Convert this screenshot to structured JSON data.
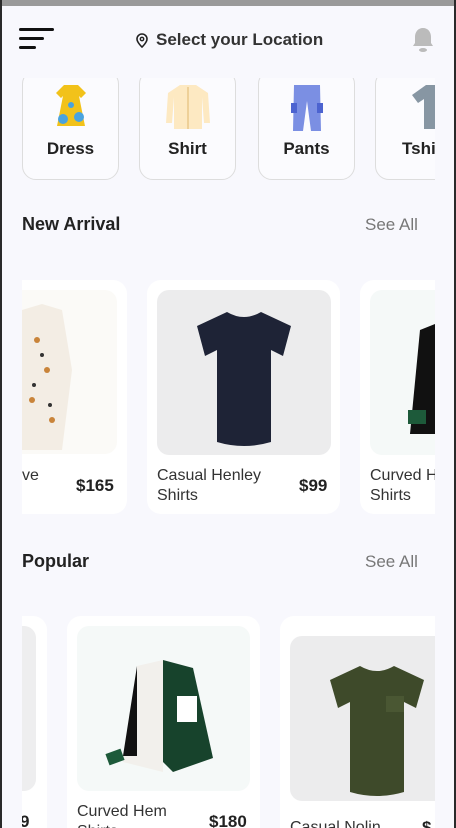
{
  "header": {
    "location_label": "Select your Location"
  },
  "categories": [
    {
      "label": "Dress"
    },
    {
      "label": "Shirt"
    },
    {
      "label": "Pants"
    },
    {
      "label": "Tshi"
    }
  ],
  "new_arrival": {
    "title": "New Arrival",
    "see_all": "See All",
    "products": [
      {
        "name": "ve",
        "price": "$165"
      },
      {
        "name": "Casual Henley Shirts",
        "price": "$99"
      },
      {
        "name": "Curved H Shirts",
        "price": ""
      }
    ]
  },
  "popular": {
    "title": "Popular",
    "see_all": "See All",
    "products": [
      {
        "name": "",
        "price": "9"
      },
      {
        "name": "Curved Hem Shirts",
        "price": "$180"
      },
      {
        "name": "Casual Nolin",
        "price": "$"
      }
    ]
  }
}
